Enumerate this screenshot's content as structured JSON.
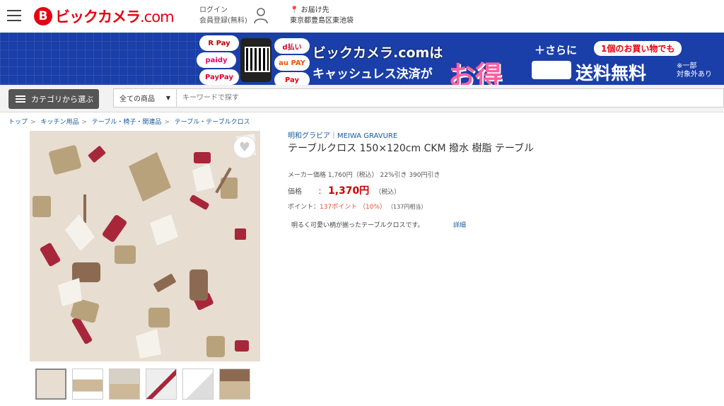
{
  "header": {
    "logo_mark": "B",
    "logo_text": "ビックカメラ",
    "logo_com": ".com",
    "login_label": "ログイン",
    "register_label": "会員登録(無料)",
    "deliver_label": "お届け先",
    "deliver_address": "東京都豊島区東池袋"
  },
  "banner": {
    "payments": [
      "R Pay",
      "paidy",
      "PayPay",
      "d払い",
      "au PAY",
      "Pay"
    ],
    "title": "ビックカメラ.comは",
    "subtitle": "キャッシュレス決済が",
    "otoku": "お得",
    "plus": "＋さらに",
    "box": "1個のお買い物でも",
    "free_shipping": "送料無料",
    "note_line1": "※一部",
    "note_line2": "対象外あり"
  },
  "search": {
    "category_button": "カテゴリから選ぶ",
    "scope": "全ての商品",
    "placeholder": "キーワードで探す"
  },
  "breadcrumbs": [
    "トップ",
    "キッチン用品",
    "テーブル・椅子・関連品",
    "テーブル・テーブルクロス"
  ],
  "product": {
    "brand": "明和グラビア｜MEIWA GRAVURE",
    "title": "テーブルクロス 150×120cm CKM 撥水 樹脂 テーブル",
    "maker_price": "メーカー価格 1,760円（税込） 22%引き 390円引き",
    "price_label": "価格",
    "price_colon": "：",
    "price": "1,370円",
    "price_tax": "（税込）",
    "points_label": "ポイント：",
    "points_value": "137ポイント （10%）",
    "points_equiv": "（137円相当）",
    "description": "明るく可愛い柄が揃ったテーブルクロスです。",
    "detail_link": "詳細"
  },
  "colors": {
    "brand_red": "#e60012",
    "banner_blue": "#1a3fa8",
    "link_blue": "#1a5aa0",
    "price_red": "#cc0000"
  }
}
